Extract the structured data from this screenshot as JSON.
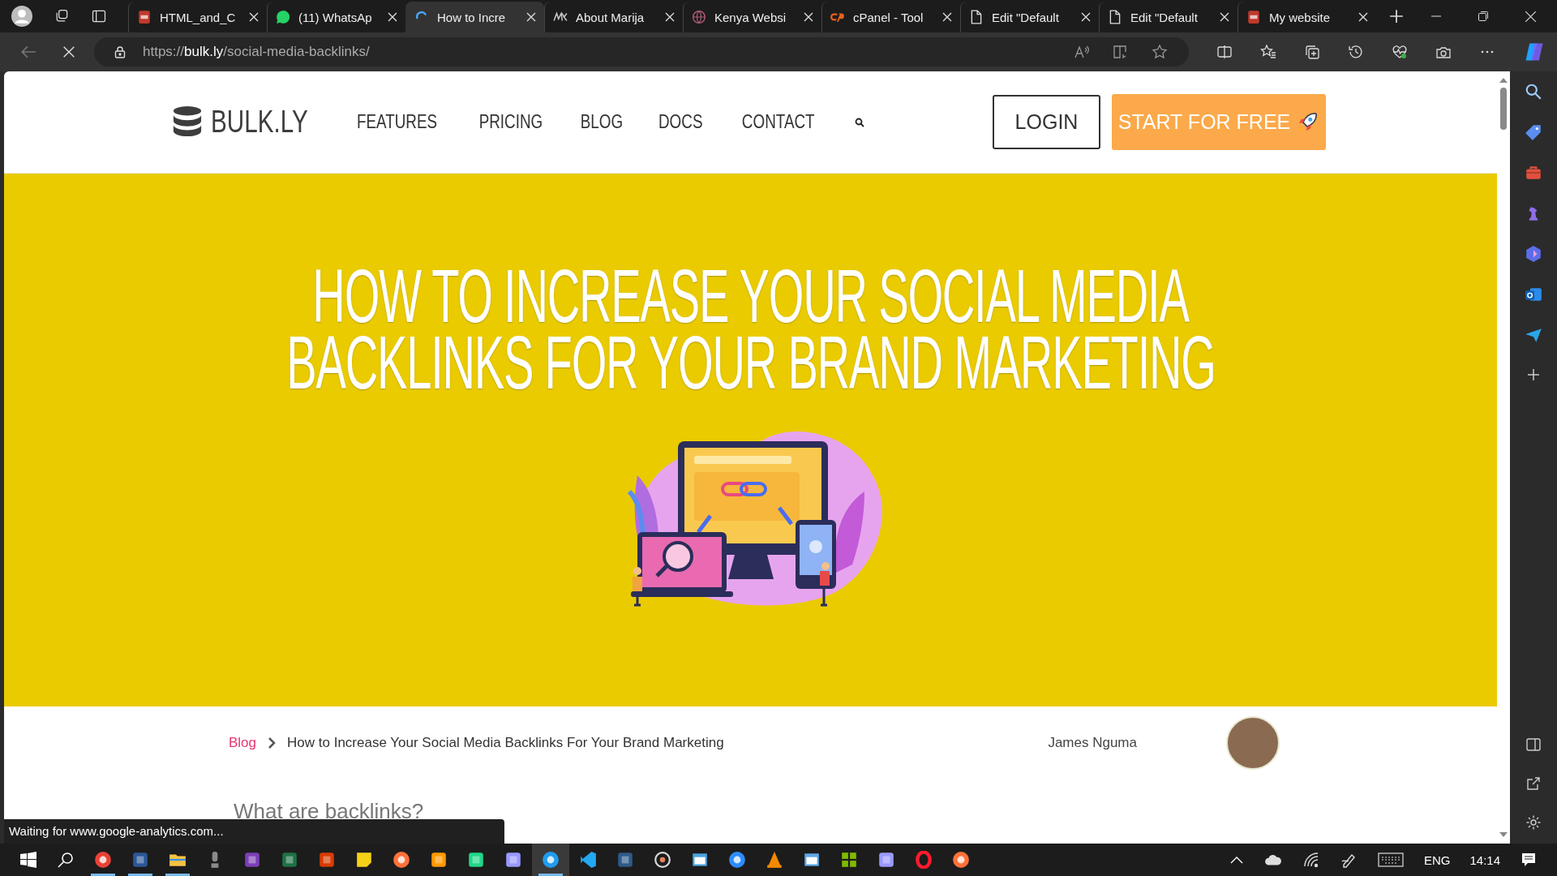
{
  "browser": {
    "tabs": [
      {
        "title": "HTML_and_C",
        "kind": "pdf",
        "selected": false
      },
      {
        "title": "(11) WhatsAp",
        "kind": "chat",
        "selected": false
      },
      {
        "title": "How to Incre",
        "kind": "loading",
        "selected": true
      },
      {
        "title": "About Marija",
        "kind": "mono",
        "selected": false
      },
      {
        "title": "Kenya Websi",
        "kind": "globe",
        "selected": false
      },
      {
        "title": "cPanel - Tool",
        "kind": "panel",
        "selected": false
      },
      {
        "title": "Edit \"Default",
        "kind": "doc",
        "selected": false
      },
      {
        "title": "Edit \"Default",
        "kind": "doc",
        "selected": false
      },
      {
        "title": "My website",
        "kind": "pdf",
        "selected": false
      }
    ],
    "url": {
      "scheme": "https://",
      "host": "bulk.ly",
      "path": "/social-media-backlinks/"
    },
    "status_text": "Waiting for www.google-analytics.com..."
  },
  "page": {
    "logo": "BULK.LY",
    "nav": [
      "FEATURES",
      "PRICING",
      "BLOG",
      "DOCS",
      "CONTACT"
    ],
    "login": "LOGIN",
    "cta": "START FOR FREE",
    "hero_title": [
      "HOW TO INCREASE YOUR SOCIAL MEDIA",
      "BACKLINKS FOR YOUR BRAND MARKETING"
    ],
    "breadcrumb": {
      "link": "Blog",
      "current": "How to Increase Your Social Media Backlinks For Your Brand Marketing"
    },
    "author": "James Nguma",
    "heading": "What are backlinks?"
  },
  "taskbar": {
    "apps": [
      {
        "kind": "browser",
        "color": "#e94235",
        "running": true,
        "selected": false
      },
      {
        "kind": "doc",
        "color": "#2b5797",
        "running": true,
        "selected": false
      },
      {
        "kind": "folder",
        "color": "#f6c342",
        "running": true,
        "selected": false
      },
      {
        "kind": "mic",
        "color": "#8a8a8a",
        "running": false,
        "selected": false
      },
      {
        "kind": "doc",
        "color": "#7b3fb5",
        "running": false,
        "selected": false
      },
      {
        "kind": "doc",
        "color": "#1e7145",
        "running": false,
        "selected": false
      },
      {
        "kind": "doc",
        "color": "#d83b01",
        "running": false,
        "selected": false
      },
      {
        "kind": "note",
        "color": "#f7d117",
        "running": false,
        "selected": false
      },
      {
        "kind": "browser",
        "color": "#ff7139",
        "running": false,
        "selected": false
      },
      {
        "kind": "doc",
        "color": "#ff9a00",
        "running": false,
        "selected": false
      },
      {
        "kind": "doc",
        "color": "#21d789",
        "running": false,
        "selected": false
      },
      {
        "kind": "doc",
        "color": "#9999ff",
        "running": false,
        "selected": false
      },
      {
        "kind": "browser",
        "color": "#1f9cf0",
        "running": true,
        "selected": true
      },
      {
        "kind": "code",
        "color": "#23a9f2",
        "running": false,
        "selected": false
      },
      {
        "kind": "doc",
        "color": "#2d5a88",
        "running": false,
        "selected": false
      },
      {
        "kind": "disc",
        "color": "#d9d9d9",
        "running": false,
        "selected": false
      },
      {
        "kind": "window",
        "color": "#4aa3df",
        "running": false,
        "selected": false
      },
      {
        "kind": "browser",
        "color": "#2d8cff",
        "running": false,
        "selected": false
      },
      {
        "kind": "cone",
        "color": "#f28a00",
        "running": false,
        "selected": false
      },
      {
        "kind": "window",
        "color": "#5fa8e8",
        "running": false,
        "selected": false
      },
      {
        "kind": "grid",
        "color": "#7fba00",
        "running": false,
        "selected": false
      },
      {
        "kind": "doc",
        "color": "#9999ff",
        "running": false,
        "selected": false
      },
      {
        "kind": "ring",
        "color": "#ff1b2d",
        "running": false,
        "selected": false
      },
      {
        "kind": "browser",
        "color": "#ff7139",
        "running": false,
        "selected": false
      }
    ],
    "language": "ENG",
    "time": "14:14"
  }
}
